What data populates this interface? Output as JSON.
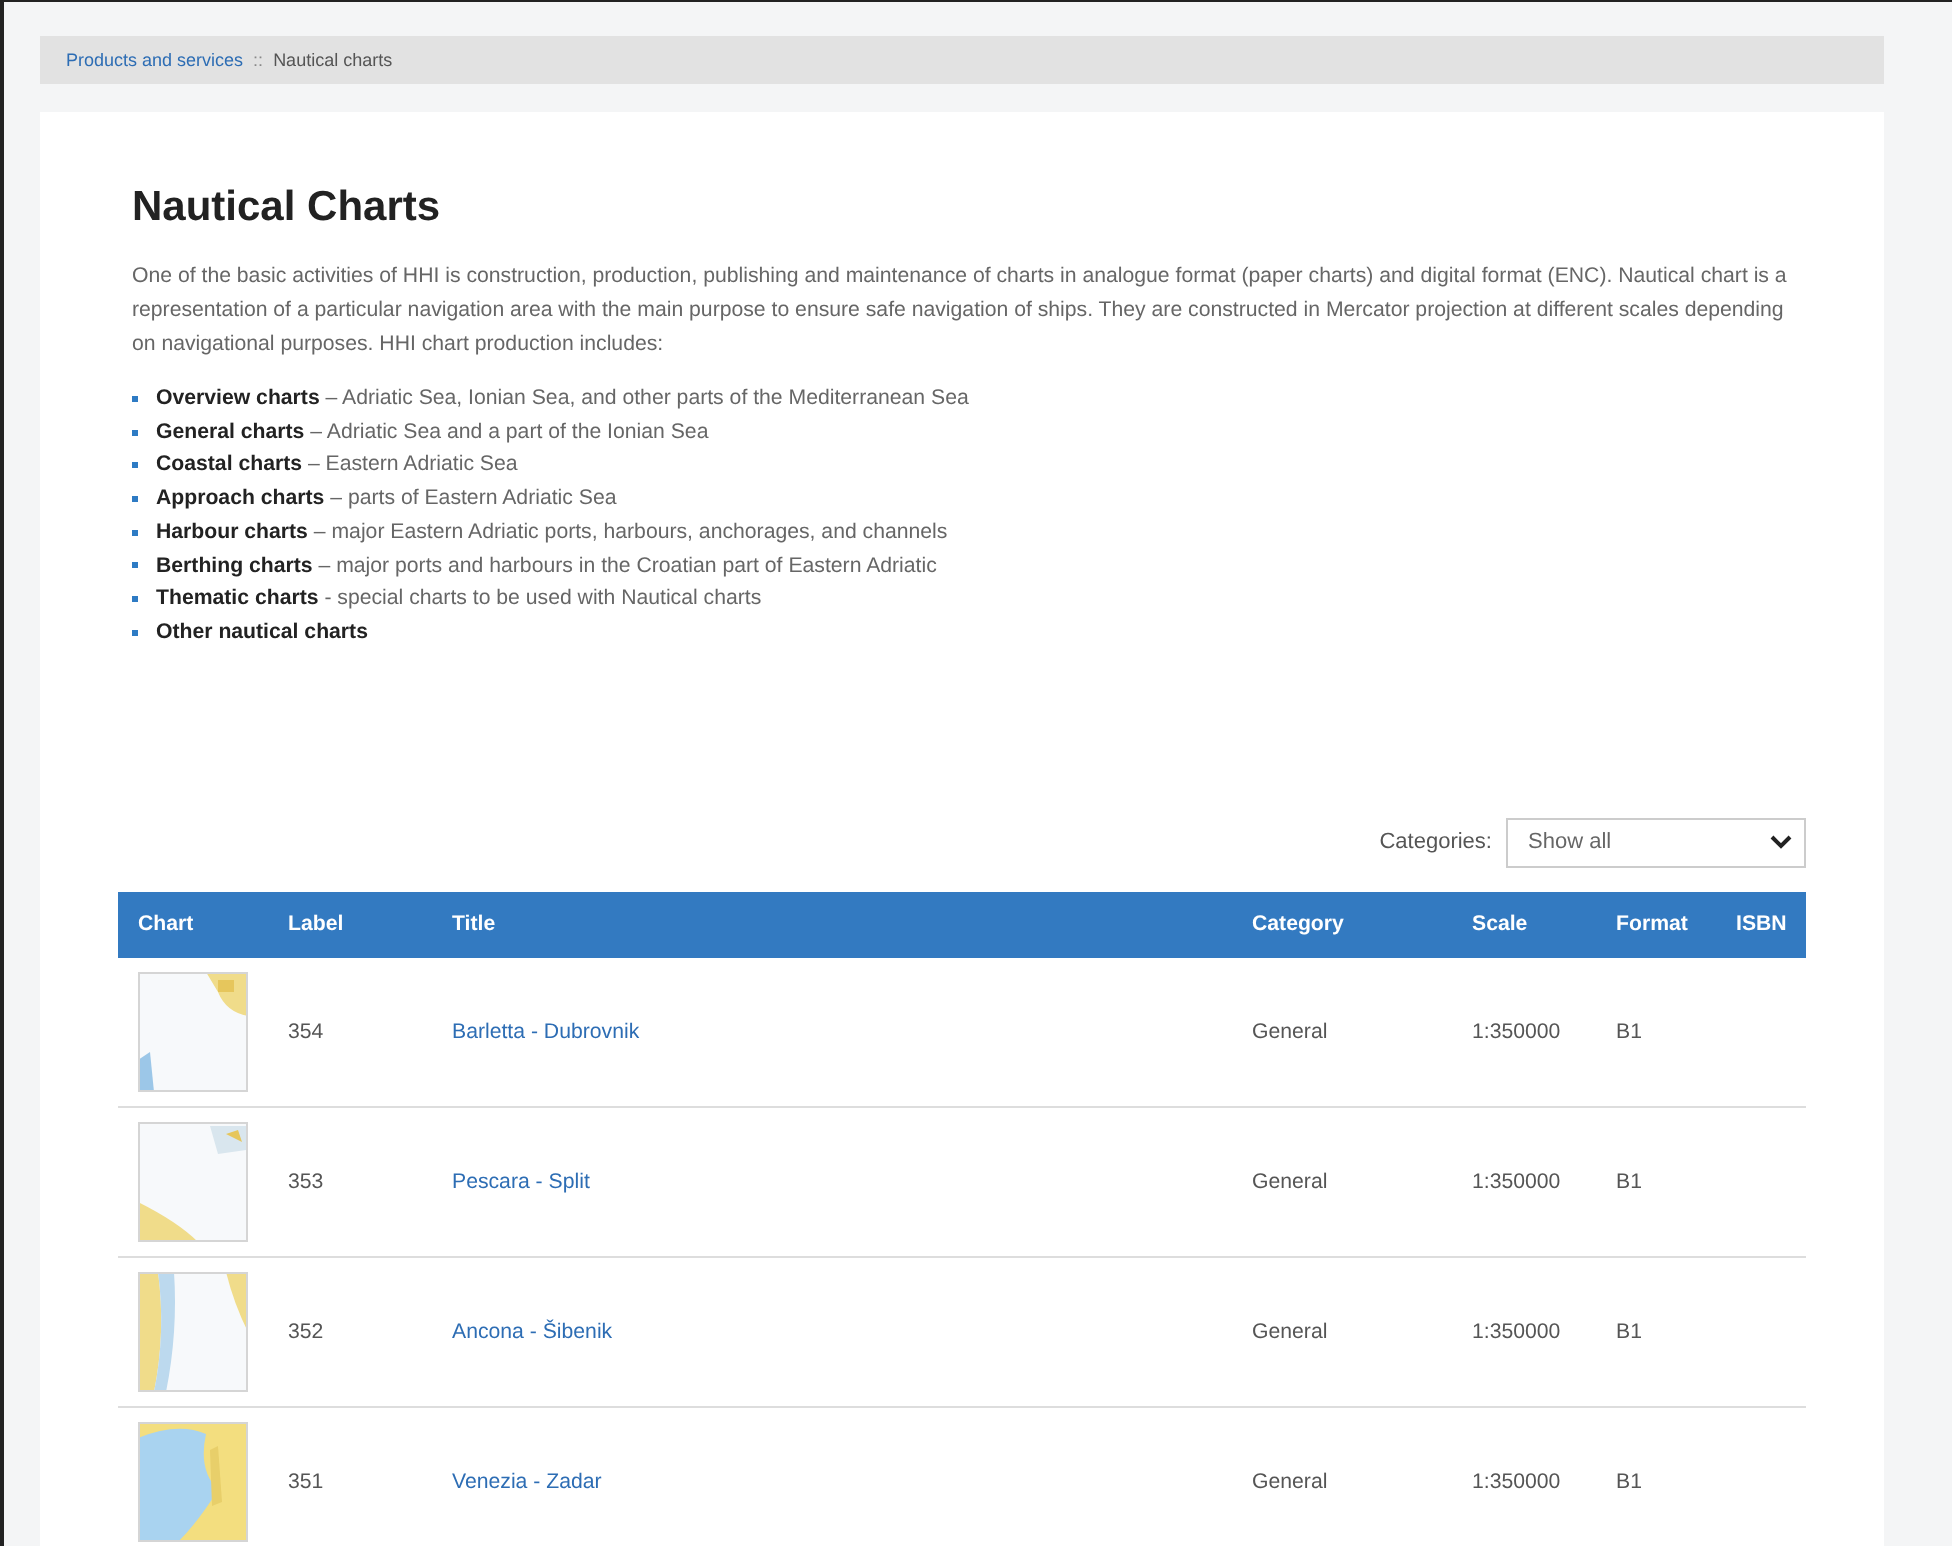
{
  "breadcrumb": [
    {
      "label": "Products and services",
      "link": true
    },
    {
      "label": "Nautical charts",
      "link": false
    }
  ],
  "breadcrumb_separator": "::",
  "title": "Nautical Charts",
  "intro": "One of the basic activities of HHI is construction, production, publishing and maintenance of charts in analogue format (paper charts) and digital format (ENC). Nautical chart is a representation of a particular navigation area with the main purpose to ensure safe navigation of ships. They are constructed in Mercator projection at different scales depending on navigational purposes. HHI chart production includes:",
  "chart_types": [
    {
      "text": "**Overview charts** – Adriatic Sea, Ionian Sea, and other parts of the Mediterranean Sea"
    },
    {
      "text": "**General charts** – Adriatic Sea and a part of the Ionian Sea"
    },
    {
      "text": "**Coastal charts** – Eastern Adriatic Sea"
    },
    {
      "text": "**Approach charts** – parts of Eastern Adriatic Sea"
    },
    {
      "text": "**Harbour charts** – major Eastern Adriatic ports, harbours, anchorages, and channels"
    },
    {
      "text": "**Berthing charts** – major ports and harbours in the Croatian part of Eastern Adriatic"
    },
    {
      "text": "**Thematic charts** - special charts to be used with Nautical charts"
    },
    {
      "text": "**Other nautical charts**"
    }
  ],
  "filter": {
    "label": "Categories:",
    "value": "Show all"
  },
  "table": {
    "columns": [
      "Chart",
      "Label",
      "Title",
      "Category",
      "Scale",
      "Format",
      "ISBN"
    ],
    "rows": [
      {
        "label": "354",
        "title": "Barletta - Dubrovnik",
        "category": "General",
        "scale": "1:350000",
        "format": "B1"
      },
      {
        "label": "353",
        "title": "Pescara - Split",
        "category": "General",
        "scale": "1:350000",
        "format": "B1"
      },
      {
        "label": "352",
        "title": "Ancona - Šibenik",
        "category": "General",
        "scale": "1:350000",
        "format": "B1"
      },
      {
        "label": "351",
        "title": "Venezia - Zadar",
        "category": "General",
        "scale": "1:350000",
        "format": "B1"
      }
    ]
  }
}
